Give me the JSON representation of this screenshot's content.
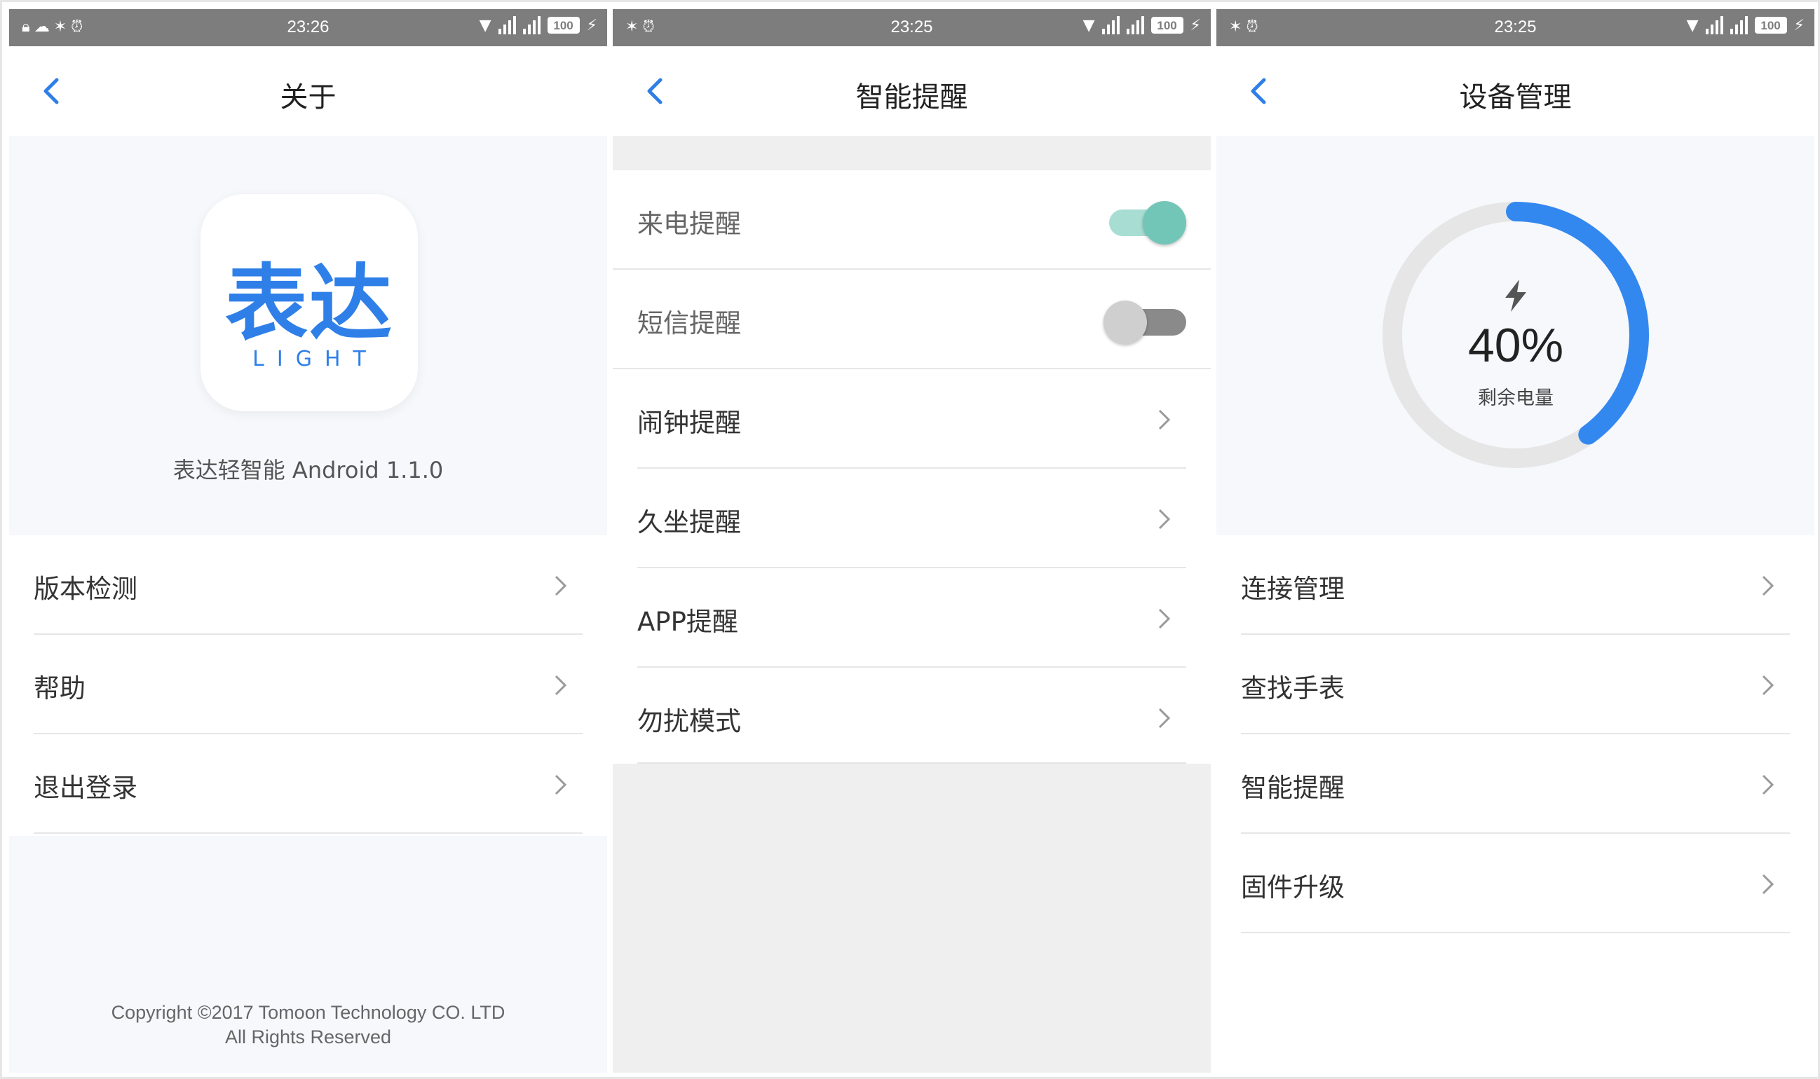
{
  "colors": {
    "accent_blue": "#2f7fe8",
    "toggle_on": "#72c6b7",
    "toggle_off": "#8a8a8a",
    "status_bar": "#7d7d7d"
  },
  "screens": {
    "about": {
      "status": {
        "time": "23:26",
        "battery": "100",
        "left_icons": [
          "lock-icon",
          "wechat-icon",
          "bluetooth-icon",
          "alarm-icon"
        ]
      },
      "title": "关于",
      "logo_main": "表达",
      "logo_sub": "LIGHT",
      "version": "表达轻智能 Android 1.1.0",
      "items": [
        {
          "label": "版本检测"
        },
        {
          "label": "帮助"
        },
        {
          "label": "退出登录"
        }
      ],
      "copyright_line1": "Copyright ©2017 Tomoon Technology CO. LTD",
      "copyright_line2": "All Rights Reserved"
    },
    "smart": {
      "status": {
        "time": "23:25",
        "battery": "100",
        "left_icons": [
          "bluetooth-icon",
          "alarm-icon"
        ]
      },
      "title": "智能提醒",
      "toggles": [
        {
          "label": "来电提醒",
          "on": true
        },
        {
          "label": "短信提醒",
          "on": false
        }
      ],
      "items": [
        {
          "label": "闹钟提醒"
        },
        {
          "label": "久坐提醒"
        },
        {
          "label": "APP提醒"
        },
        {
          "label": "勿扰模式"
        }
      ]
    },
    "device": {
      "status": {
        "time": "23:25",
        "battery": "100",
        "left_icons": [
          "bluetooth-icon",
          "alarm-icon"
        ]
      },
      "title": "设备管理",
      "battery_percent": 40,
      "battery_text": "40%",
      "battery_label": "剩余电量",
      "items": [
        {
          "label": "连接管理"
        },
        {
          "label": "查找手表"
        },
        {
          "label": "智能提醒"
        },
        {
          "label": "固件升级"
        }
      ]
    }
  }
}
